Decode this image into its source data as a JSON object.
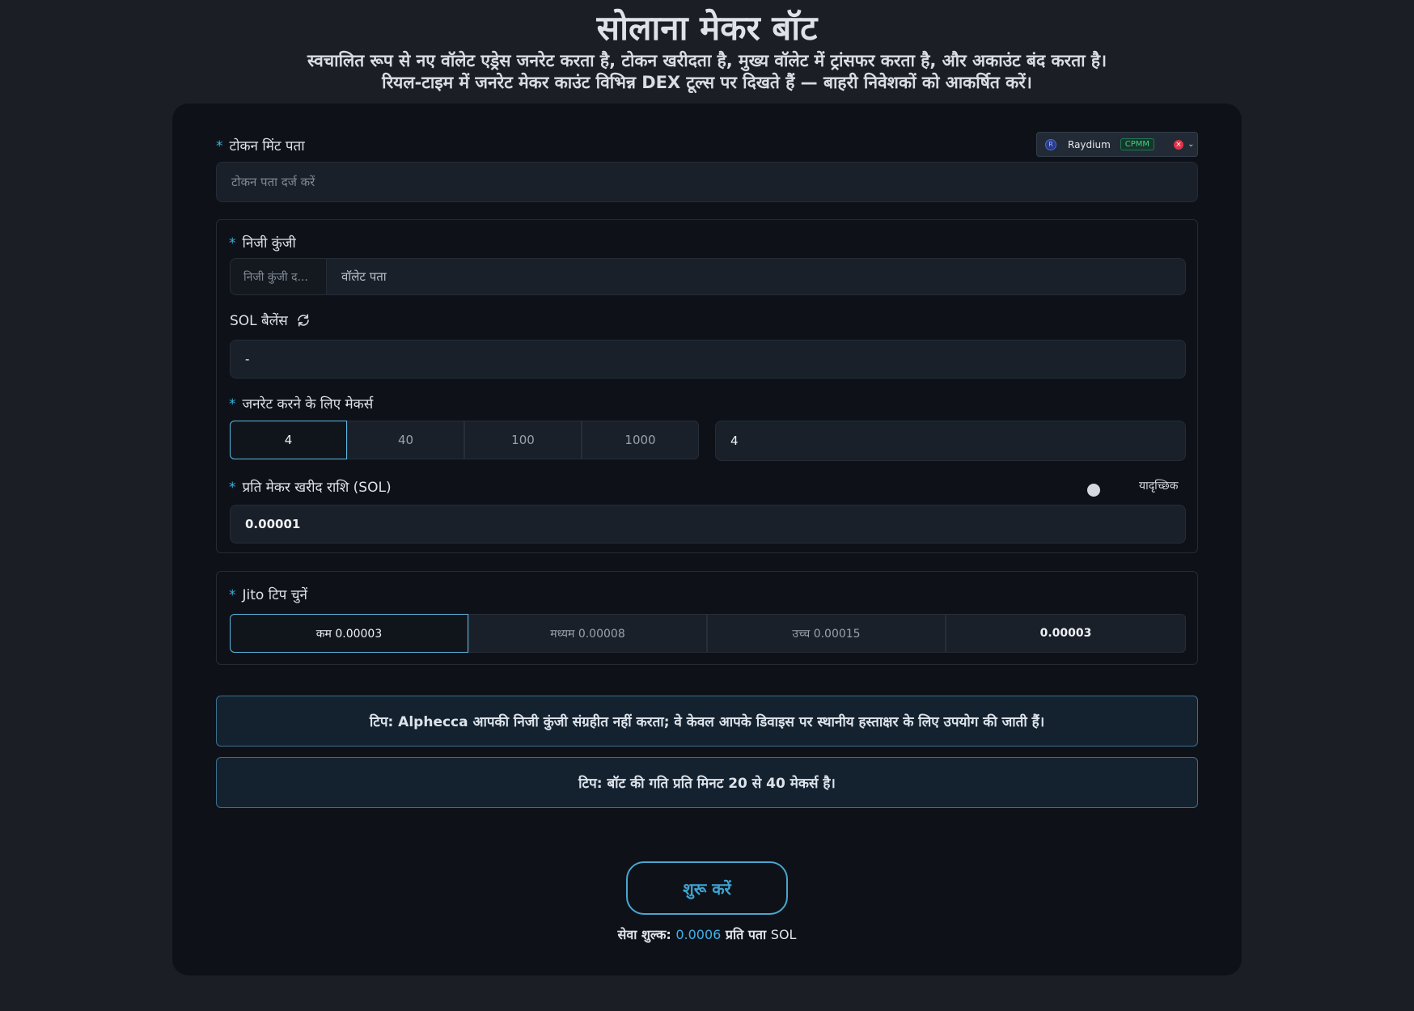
{
  "header": {
    "title": "सोलाना मेकर बॉट",
    "subtitle_line1": "स्वचालित रूप से नए वॉलेट एड्रेस जनरेट करता है, टोकन खरीदता है, मुख्य वॉलेट में ट्रांसफर करता है, और अकाउंट बंद करता है।",
    "subtitle_line2": "रियल-टाइम में जनरेट मेकर काउंट विभिन्न DEX टूल्स पर दिखते हैं — बाहरी निवेशकों को आकर्षित करें।"
  },
  "token": {
    "label": "टोकन मिंट पता",
    "placeholder": "टोकन पता दर्ज करें",
    "dex": {
      "name": "Raydium",
      "badge": "CPMM",
      "logo_icon": "raydium-logo-icon",
      "clear_icon": "clear-icon",
      "dropdown_icon": "chevron-down-icon"
    }
  },
  "wallet": {
    "private_key_label": "निजी कुंजी",
    "private_key_placeholder": "निजी कुंजी द...",
    "address_placeholder": "वॉलेट पता",
    "balance_label": "SOL बैलेंस",
    "balance_value": "-",
    "refresh_icon": "refresh-icon",
    "makers_label": "जनरेट करने के लिए मेकर्स",
    "makers_options": [
      "4",
      "40",
      "100",
      "1000"
    ],
    "makers_selected": "4",
    "makers_value": "4",
    "amount_label": "प्रति मेकर खरीद राशि (SOL)",
    "random_label": "यादृच्छिक",
    "amount_value": "0.00001"
  },
  "jito": {
    "label": "Jito टिप चुनें",
    "options": [
      "कम 0.00003",
      "मध्यम 0.00008",
      "उच्च 0.00015",
      "0.00003"
    ],
    "selected": "कम 0.00003"
  },
  "tips": [
    "टिप: Alphecca आपकी निजी कुंजी संग्रहीत नहीं करता; वे केवल आपके डिवाइस पर स्थानीय हस्ताक्षर के लिए उपयोग की जाती हैं।",
    "टिप: बॉट की गति प्रति मिनट 20 से 40 मेकर्स है।"
  ],
  "start_button": "शुरू करें",
  "fee": {
    "prefix": "सेवा शुल्क:",
    "amount": "0.0006",
    "suffix": "प्रति पता",
    "unit": "SOL"
  },
  "colors": {
    "accent": "#3fb0e8",
    "background": "#1b1f25",
    "card": "#0e1218"
  }
}
